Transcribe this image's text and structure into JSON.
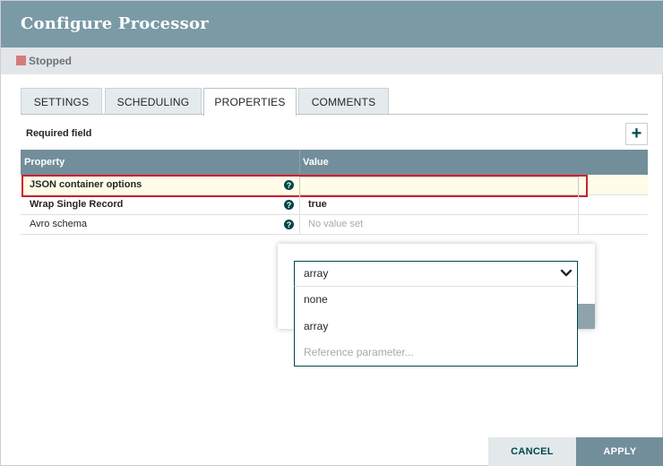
{
  "dialog": {
    "title": "Configure Processor",
    "status": "Stopped",
    "status_color": "#d47c7c",
    "header_color": "#7a9aa5"
  },
  "tabs": [
    {
      "label": "SETTINGS",
      "active": false
    },
    {
      "label": "SCHEDULING",
      "active": false
    },
    {
      "label": "PROPERTIES",
      "active": true
    },
    {
      "label": "COMMENTS",
      "active": false
    }
  ],
  "properties": {
    "required_label": "Required field",
    "add_icon": "plus-icon",
    "columns": [
      "Property",
      "Value"
    ],
    "rows": [
      {
        "name": "JSON container options",
        "value": "",
        "required": true,
        "help_icon": "question-icon"
      },
      {
        "name": "Wrap Single Record",
        "value": "true",
        "required": true,
        "help_icon": "question-icon"
      },
      {
        "name": "Avro schema",
        "value": "No value set",
        "required": false,
        "help_icon": "question-icon"
      }
    ]
  },
  "editor": {
    "selected": "array",
    "chevron_icon": "chevron-down-icon",
    "options": [
      "none",
      "array",
      "Reference parameter..."
    ]
  },
  "footer": {
    "cancel_label": "CANCEL",
    "apply_label": "APPLY"
  },
  "colors": {
    "accent": "#004849",
    "table_header": "#728e9b",
    "highlight_row": "#fffce8",
    "selection_border": "#d0202f"
  }
}
